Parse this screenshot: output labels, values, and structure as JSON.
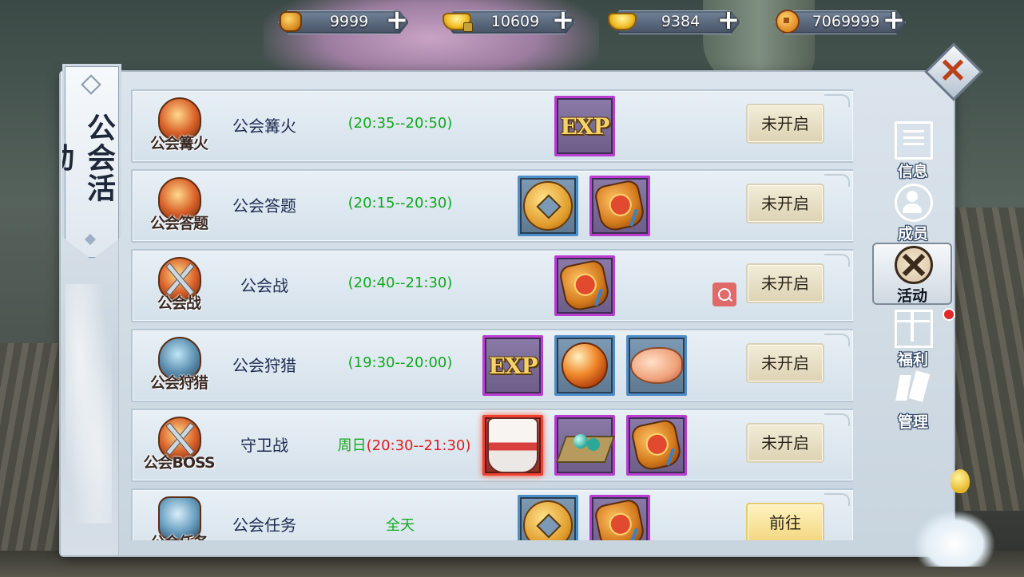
{
  "currencies": [
    {
      "icon": "coin-bag-icon",
      "value": "9999"
    },
    {
      "icon": "locked-gold-ingot-icon",
      "value": "10609"
    },
    {
      "icon": "gold-ingot-icon",
      "value": "9384"
    },
    {
      "icon": "copper-coin-icon",
      "value": "7069999"
    }
  ],
  "banner": {
    "title": "公会活动"
  },
  "activities": [
    {
      "icon_label": "公会篝火",
      "name": "公会篝火",
      "time": "(20:35--20:50)",
      "rewards": [
        "exp"
      ],
      "button": "未开启"
    },
    {
      "icon_label": "公会答题",
      "name": "公会答题",
      "time": "(20:15--20:30)",
      "rewards": [
        "copper-coin",
        "money-pouch"
      ],
      "button": "未开启"
    },
    {
      "icon_label": "公会战",
      "name": "公会战",
      "time": "(20:40--21:30)",
      "rewards": [
        "money-pouch"
      ],
      "button": "未开启"
    },
    {
      "icon_label": "公会狩猎",
      "name": "公会狩猎",
      "time": "(19:30--20:00)",
      "rewards": [
        "exp",
        "fire-orb",
        "roast-chicken"
      ],
      "button": "未开启"
    },
    {
      "icon_label": "公会BOSS",
      "name": "守卫战",
      "time_prefix": "周日",
      "time": "(20:30--21:30)",
      "rewards": [
        "armor",
        "gem-tray",
        "money-pouch"
      ],
      "button": "未开启"
    },
    {
      "icon_label": "公会任务",
      "name": "公会任务",
      "time": "全天",
      "rewards": [
        "copper-coin",
        "money-pouch"
      ],
      "button": "前往"
    }
  ],
  "reward_labels": {
    "exp": "EXP"
  },
  "tabs": [
    {
      "id": "info",
      "label": "信息",
      "icon": "scroll-icon"
    },
    {
      "id": "members",
      "label": "成员",
      "icon": "member-icon"
    },
    {
      "id": "activities",
      "label": "活动",
      "icon": "crossed-swords-icon",
      "active": true
    },
    {
      "id": "welfare",
      "label": "福利",
      "icon": "gift-icon"
    },
    {
      "id": "manage",
      "label": "管理",
      "icon": "manage-icon"
    }
  ],
  "colors": {
    "time_green": "#12a81e",
    "time_red": "#e01b1b",
    "reward_purple": "#b83dd0",
    "reward_blue": "#4e8ec8",
    "reward_red": "#f04030",
    "close_x": "#b8431a"
  }
}
